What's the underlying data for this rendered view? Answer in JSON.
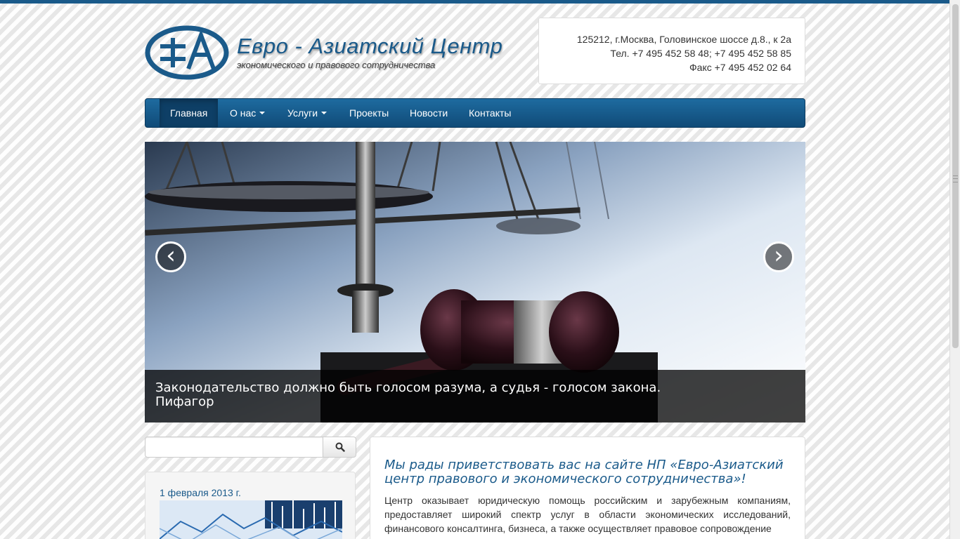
{
  "header": {
    "logo_title": "Евро - Азиатский Центр",
    "logo_subtitle": "экономического и правового сотрудничества",
    "address": "125212, г.Москва, Головинское шоссе д.8., к 2а",
    "phone": "Тел. +7 495 452 58 48; +7 495 452 58 85",
    "fax": "Факс +7 495 452 02 64"
  },
  "nav": {
    "items": [
      {
        "label": "Главная",
        "active": true,
        "dropdown": false
      },
      {
        "label": "О нас",
        "active": false,
        "dropdown": true
      },
      {
        "label": "Услуги",
        "active": false,
        "dropdown": true
      },
      {
        "label": "Проекты",
        "active": false,
        "dropdown": false
      },
      {
        "label": "Новости",
        "active": false,
        "dropdown": false
      },
      {
        "label": "Контакты",
        "active": false,
        "dropdown": false
      }
    ]
  },
  "carousel": {
    "prev_icon": "‹",
    "next_icon": "›",
    "caption_line1": "Законодательство должно быть голосом разума, а судья - голосом закона.",
    "caption_line2": "Пифагор"
  },
  "search": {
    "placeholder": "",
    "icon": "search-icon"
  },
  "news": {
    "date": "1 февраля 2013 г."
  },
  "main": {
    "title": "Мы рады приветствовать вас на сайте НП «Евро-Азиатский центр правового и экономического сотрудничества»!",
    "text": "Центр оказывает юридическую помощь российским и зарубежным компаниям, предоставляет широкий спектр услуг в области экономических исследований, финансового консалтинга, бизнеса, а также осуществляет правовое сопровождение"
  },
  "colors": {
    "brand": "#1a5a8a",
    "nav_dark": "#0e3f66"
  }
}
